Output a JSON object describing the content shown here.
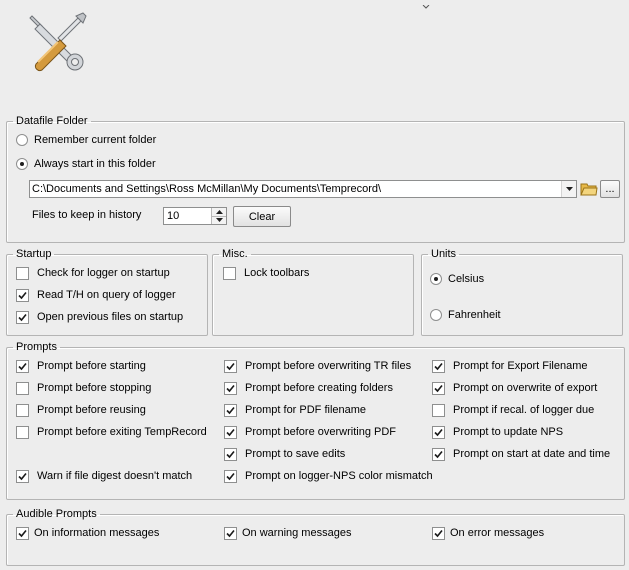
{
  "header": {
    "icon": "tools-icon"
  },
  "datafile_folder": {
    "legend": "Datafile Folder",
    "remember_label": "Remember current folder",
    "remember_selected": false,
    "always_label": "Always start in this folder",
    "always_selected": true,
    "path_value": "C:\\Documents and Settings\\Ross McMillan\\My Documents\\Temprecord\\",
    "history_label": "Files to keep in history",
    "history_value": "10",
    "clear_label": "Clear",
    "browse_more_label": "..."
  },
  "startup": {
    "legend": "Startup",
    "items": [
      {
        "label": "Check for logger on startup",
        "checked": false
      },
      {
        "label": "Read T/H on query of logger",
        "checked": true
      },
      {
        "label": "Open previous files on startup",
        "checked": true
      }
    ]
  },
  "misc": {
    "legend": "Misc.",
    "items": [
      {
        "label": "Lock toolbars",
        "checked": false
      }
    ]
  },
  "units": {
    "legend": "Units",
    "options": [
      {
        "label": "Celsius",
        "selected": true
      },
      {
        "label": "Fahrenheit",
        "selected": false
      }
    ]
  },
  "prompts": {
    "legend": "Prompts",
    "col1": [
      {
        "label": "Prompt before starting",
        "checked": true
      },
      {
        "label": "Prompt before stopping",
        "checked": false
      },
      {
        "label": "Prompt before reusing",
        "checked": false
      },
      {
        "label": "Prompt before exiting TempRecord",
        "checked": false
      },
      {
        "label": "Warn if file digest doesn't match",
        "checked": true
      }
    ],
    "col2": [
      {
        "label": "Prompt before overwriting TR files",
        "checked": true
      },
      {
        "label": "Prompt before creating folders",
        "checked": true
      },
      {
        "label": "Prompt for PDF filename",
        "checked": true
      },
      {
        "label": "Prompt before overwriting PDF",
        "checked": true
      },
      {
        "label": "Prompt to save edits",
        "checked": true
      },
      {
        "label": "Prompt on logger-NPS color mismatch",
        "checked": true
      }
    ],
    "col3": [
      {
        "label": "Prompt for Export Filename",
        "checked": true
      },
      {
        "label": "Prompt on overwrite of export",
        "checked": true
      },
      {
        "label": "Prompt if recal. of logger due",
        "checked": false
      },
      {
        "label": "Prompt to update NPS",
        "checked": true
      },
      {
        "label": "Prompt on start at date and time",
        "checked": true
      }
    ]
  },
  "audible": {
    "legend": "Audible Prompts",
    "items": [
      {
        "label": "On information messages",
        "checked": true
      },
      {
        "label": "On warning messages",
        "checked": true
      },
      {
        "label": "On error messages",
        "checked": true
      }
    ]
  }
}
